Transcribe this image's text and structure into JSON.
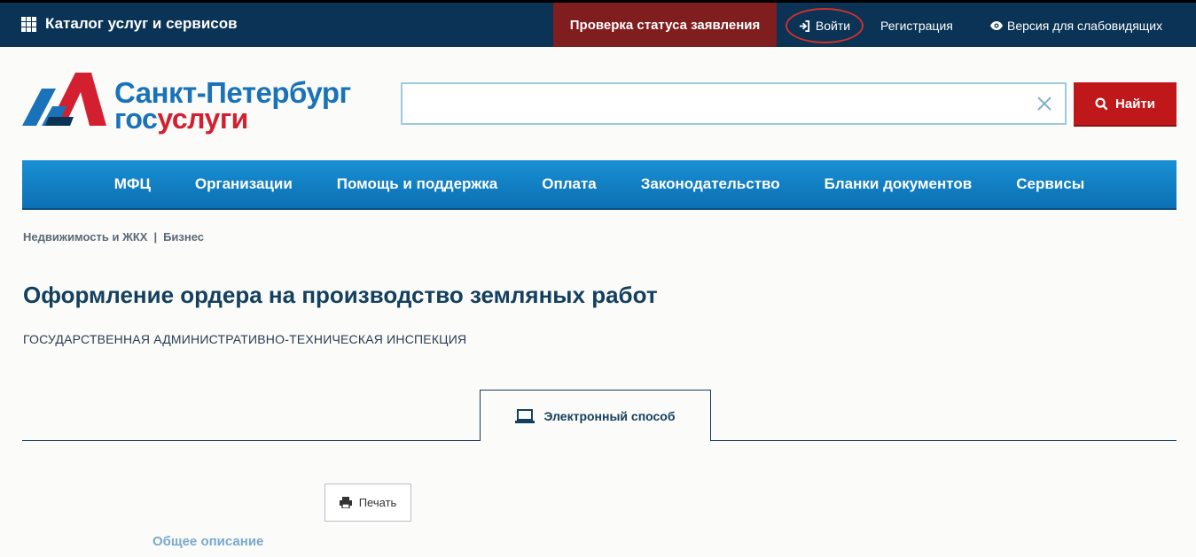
{
  "topbar": {
    "catalog_label": "Каталог услуг и сервисов",
    "status_check_label": "Проверка статуса заявления",
    "login_label": "Войти",
    "register_label": "Регистрация",
    "low_vision_label": "Версия для слабовидящих"
  },
  "logo": {
    "city": "Санкт-Петербург",
    "gos_part1": "гос",
    "gos_part2": "услуги"
  },
  "search": {
    "placeholder": "",
    "value": "",
    "button_label": "Найти"
  },
  "nav": {
    "items": [
      "МФЦ",
      "Организации",
      "Помощь и поддержка",
      "Оплата",
      "Законодательство",
      "Бланки документов",
      "Сервисы"
    ]
  },
  "breadcrumbs": {
    "items": [
      "Недвижимость и ЖКХ",
      "Бизнес"
    ],
    "separator": "|"
  },
  "page": {
    "title": "Оформление ордера на производство земляных работ",
    "agency": "ГОСУДАРСТВЕННАЯ АДМИНИСТРАТИВНО-ТЕХНИЧЕСКАЯ ИНСПЕКЦИЯ"
  },
  "tabs": {
    "electronic_label": "Электронный способ"
  },
  "actions": {
    "print_label": "Печать"
  },
  "sections": {
    "overview_label": "Общее описание"
  },
  "colors": {
    "topbar_bg": "#0a3355",
    "status_bg": "#7f1d1f",
    "nav_bg": "#0b70b3",
    "search_btn_bg": "#c0171a",
    "brand_blue": "#1a73b8",
    "brand_red": "#d32030",
    "login_highlight": "#d0302e"
  }
}
